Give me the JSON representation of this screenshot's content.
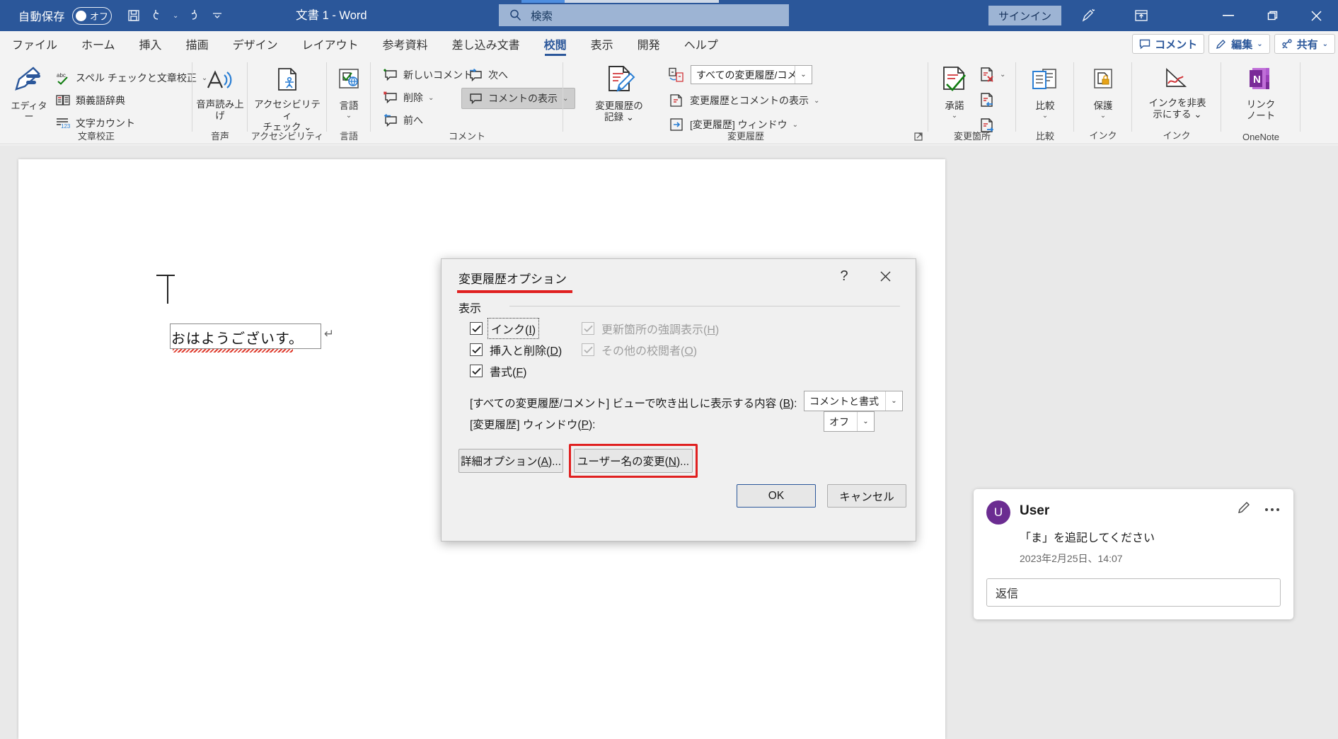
{
  "titlebar": {
    "autosave_label": "自動保存",
    "autosave_state": "オフ",
    "document_title": "文書 1  -  Word",
    "search_placeholder": "検索",
    "signin_label": "サインイン",
    "accent_color": "#2b579a"
  },
  "tabs": [
    {
      "label": "ファイル",
      "active": false
    },
    {
      "label": "ホーム",
      "active": false
    },
    {
      "label": "挿入",
      "active": false
    },
    {
      "label": "描画",
      "active": false
    },
    {
      "label": "デザイン",
      "active": false
    },
    {
      "label": "レイアウト",
      "active": false
    },
    {
      "label": "参考資料",
      "active": false
    },
    {
      "label": "差し込み文書",
      "active": false
    },
    {
      "label": "校閲",
      "active": true
    },
    {
      "label": "表示",
      "active": false
    },
    {
      "label": "開発",
      "active": false
    },
    {
      "label": "ヘルプ",
      "active": false
    }
  ],
  "tabbar_right": [
    {
      "label": "コメント"
    },
    {
      "label": "編集"
    },
    {
      "label": "共有"
    }
  ],
  "ribbon": {
    "groups": [
      {
        "name": "文章校正",
        "big_button": "エディター",
        "items": [
          "スペル チェックと文章校正",
          "類義語辞典",
          "文字カウント"
        ]
      },
      {
        "name": "音声",
        "big_button": "音声読み上げ"
      },
      {
        "name": "アクセシビリティ",
        "big_button": "アクセシビリティ チェック"
      },
      {
        "name": "言語",
        "big_button": "言語"
      },
      {
        "name": "コメント",
        "items": [
          "新しいコメント",
          "削除",
          "前へ",
          "次へ"
        ],
        "toggle": "コメントの表示"
      },
      {
        "name": "変更履歴",
        "big_button": "変更履歴の 記録",
        "combo_value": "すべての変更履歴/コメ…",
        "items": [
          "変更履歴とコメントの表示",
          "[変更履歴] ウィンドウ"
        ]
      },
      {
        "name": "変更箇所",
        "big_button": "承諾"
      },
      {
        "name": "比較",
        "big_button": "比較"
      },
      {
        "name": "インク",
        "big_button": "保護",
        "second_button": "インクを非表 示にする"
      },
      {
        "name": "OneNote",
        "big_button": "リンク ノート"
      }
    ]
  },
  "document": {
    "body_text": "おはようございす。",
    "paragraph_mark": "↵"
  },
  "comment": {
    "avatar_initial": "U",
    "author": "User",
    "text": "「ま」を追記してください",
    "timestamp": "2023年2月25日、14:07",
    "reply_placeholder": "返信",
    "avatar_color": "#6b2c91"
  },
  "dialog": {
    "title": "変更履歴オプション",
    "help_glyph": "?",
    "section_display": "表示",
    "checkboxes_left": [
      {
        "label_before": "インク(",
        "accel": "I",
        "label_after": ")",
        "checked": true,
        "disabled": false,
        "focused": true
      },
      {
        "label_before": "挿入と削除(",
        "accel": "D",
        "label_after": ")",
        "checked": true,
        "disabled": false,
        "focused": false
      },
      {
        "label_before": "書式(",
        "accel": "F",
        "label_after": ")",
        "checked": true,
        "disabled": false,
        "focused": false
      }
    ],
    "checkboxes_right": [
      {
        "label_before": "更新箇所の強調表示(",
        "accel": "H",
        "label_after": ")",
        "checked": true,
        "disabled": true,
        "focused": false
      },
      {
        "label_before": "その他の校閲者(",
        "accel": "O",
        "label_after": ")",
        "checked": true,
        "disabled": true,
        "focused": false
      }
    ],
    "row_balloon_label_before": "[すべての変更履歴/コメント] ビューで吹き出しに表示する内容 (",
    "row_balloon_accel": "B",
    "row_balloon_label_after": "):",
    "row_balloon_value": "コメントと書式",
    "row_pane_label_before": "[変更履歴] ウィンドウ(",
    "row_pane_accel": "P",
    "row_pane_label_after": "):",
    "row_pane_value": "オフ",
    "btn_advanced_before": "詳細オプション(",
    "btn_advanced_accel": "A",
    "btn_advanced_after": ")...",
    "btn_username_before": "ユーザー名の変更(",
    "btn_username_accel": "N",
    "btn_username_after": ")...",
    "btn_ok": "OK",
    "btn_cancel": "キャンセル",
    "highlight_color": "#e02020"
  }
}
